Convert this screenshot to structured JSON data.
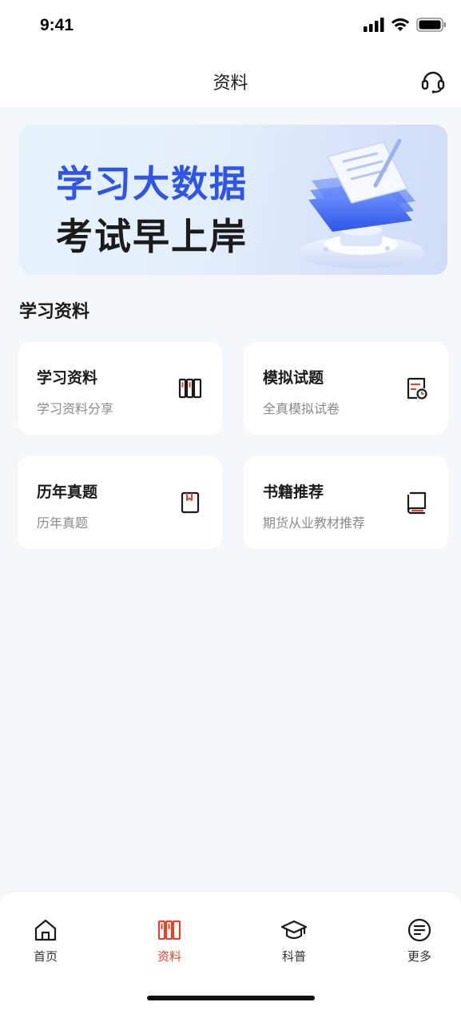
{
  "status": {
    "time": "9:41"
  },
  "header": {
    "title": "资料"
  },
  "banner": {
    "line1": "学习大数据",
    "line2": "考试早上岸"
  },
  "section": {
    "title": "学习资料"
  },
  "cards": [
    {
      "title": "学习资料",
      "subtitle": "学习资料分享",
      "icon": "books-icon"
    },
    {
      "title": "模拟试题",
      "subtitle": "全真模拟试卷",
      "icon": "exam-paper-icon"
    },
    {
      "title": "历年真题",
      "subtitle": "历年真题",
      "icon": "bookmark-icon"
    },
    {
      "title": "书籍推荐",
      "subtitle": "期货从业教材推荐",
      "icon": "book-icon"
    }
  ],
  "tabs": [
    {
      "label": "首页",
      "icon": "home-icon",
      "active": false
    },
    {
      "label": "资料",
      "icon": "books-icon",
      "active": true
    },
    {
      "label": "科普",
      "icon": "graduation-cap-icon",
      "active": false
    },
    {
      "label": "更多",
      "icon": "menu-circle-icon",
      "active": false
    }
  ],
  "colors": {
    "accent": "#e0452d",
    "banner_blue": "#2f55e8",
    "background": "#f6f7f9"
  }
}
